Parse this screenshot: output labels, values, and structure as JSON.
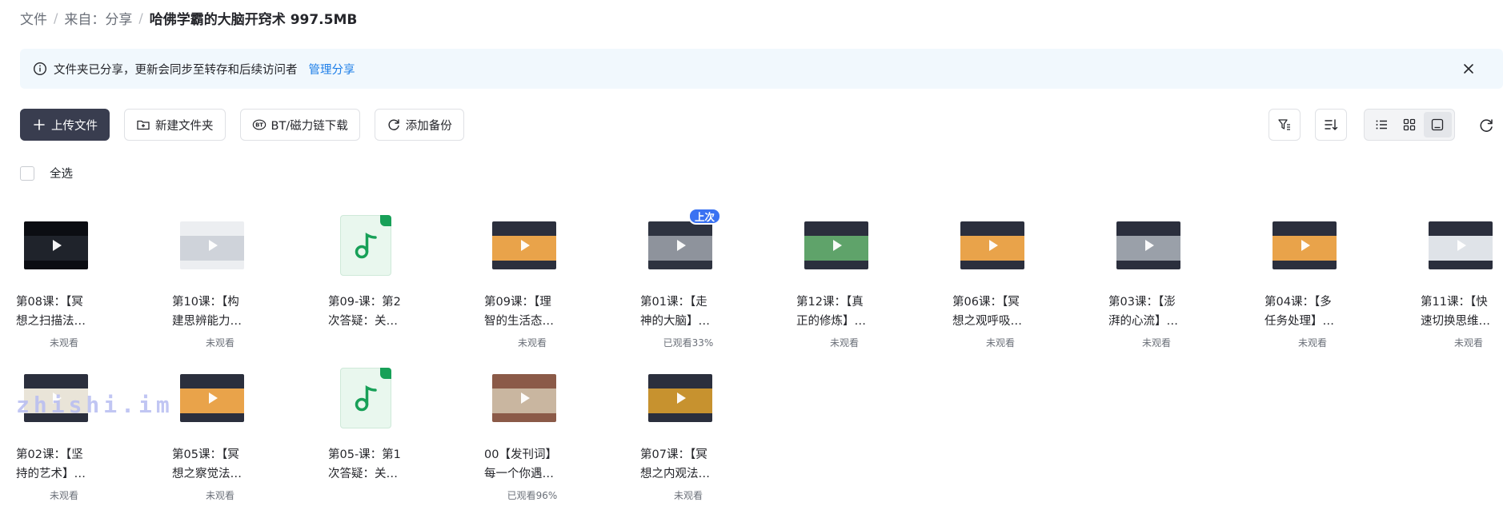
{
  "breadcrumb": [
    "文件",
    "来自：分享",
    "哈佛学霸的大脑开窍术 997.5MB"
  ],
  "notice": {
    "text": "文件夹已分享，更新会同步至转存和后续访问者",
    "link": "管理分享"
  },
  "toolbar": {
    "upload": "上传文件",
    "new_folder": "新建文件夹",
    "bt": "BT/磁力链下载",
    "backup": "添加备份"
  },
  "select_all": "全选",
  "watermark": "zhishi.im",
  "files": [
    {
      "line1": "第08课：【冥",
      "line2": "想之扫描法…",
      "status": "未观看",
      "type": "video",
      "colors": [
        "#0b0d12",
        "#1f232b"
      ]
    },
    {
      "line1": "第10课：【构",
      "line2": "建思辨能力…",
      "status": "未观看",
      "type": "video",
      "colors": [
        "#eceef1",
        "#cfd3da"
      ]
    },
    {
      "line1": "第09-课：第2",
      "line2": "次答疑：关…",
      "status": "",
      "type": "audio"
    },
    {
      "line1": "第09课：【理",
      "line2": "智的生活态…",
      "status": "未观看",
      "type": "video",
      "colors": [
        "#2b2f3d",
        "#e9a34a"
      ]
    },
    {
      "line1": "第01课：【走",
      "line2": "神的大脑】…",
      "status": "已观看33%",
      "type": "video",
      "colors": [
        "#2e3340",
        "#8e939c"
      ],
      "badge": "上次"
    },
    {
      "line1": "第12课：【真",
      "line2": "正的修炼】…",
      "status": "未观看",
      "type": "video",
      "colors": [
        "#2b2f3d",
        "#5fa36a"
      ]
    },
    {
      "line1": "第06课：【冥",
      "line2": "想之观呼吸…",
      "status": "未观看",
      "type": "video",
      "colors": [
        "#2b2f3d",
        "#e9a34a"
      ]
    },
    {
      "line1": "第03课：【澎",
      "line2": "湃的心流】…",
      "status": "未观看",
      "type": "video",
      "colors": [
        "#2b2f3d",
        "#9aa0a9"
      ]
    },
    {
      "line1": "第04课：【多",
      "line2": "任务处理】…",
      "status": "未观看",
      "type": "video",
      "colors": [
        "#2b2f3d",
        "#e9a34a"
      ]
    },
    {
      "line1": "第11课：【快",
      "line2": "速切换思维…",
      "status": "未观看",
      "type": "video",
      "colors": [
        "#2b2f3d",
        "#dfe3e8"
      ]
    },
    {
      "line1": "第02课：【坚",
      "line2": "持的艺术】…",
      "status": "未观看",
      "type": "video",
      "colors": [
        "#2b2f3d",
        "#e9e4d8"
      ]
    },
    {
      "line1": "第05课：【冥",
      "line2": "想之察觉法…",
      "status": "未观看",
      "type": "video",
      "colors": [
        "#2b2f3d",
        "#e9a34a"
      ]
    },
    {
      "line1": "第05-课：第1",
      "line2": "次答疑：关…",
      "status": "",
      "type": "audio"
    },
    {
      "line1": "00【发刊词】",
      "line2": "每一个你遇…",
      "status": "已观看96%",
      "type": "video",
      "colors": [
        "#8b5a48",
        "#c9b6a0"
      ]
    },
    {
      "line1": "第07课：【冥",
      "line2": "想之内观法…",
      "status": "未观看",
      "type": "video",
      "colors": [
        "#2b2f3d",
        "#c7922f"
      ]
    }
  ]
}
